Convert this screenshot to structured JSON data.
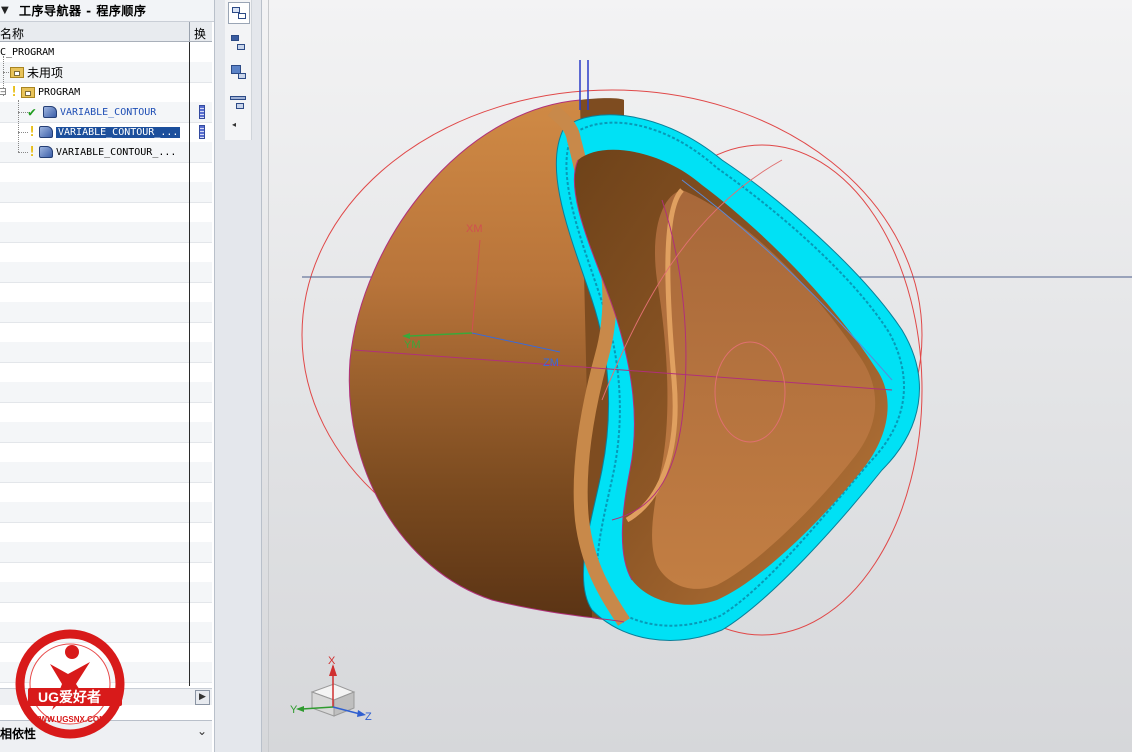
{
  "navigator": {
    "title": "工序导航器 - 程序顺序",
    "header": {
      "name_col": "名称",
      "swap_col": "换"
    },
    "rows": [
      {
        "label": "C_PROGRAM",
        "level": 0
      },
      {
        "label": "未用项",
        "level": 1
      },
      {
        "label": "PROGRAM",
        "level": 1
      },
      {
        "label": "VARIABLE_CONTOUR",
        "level": 2,
        "status": "complete"
      },
      {
        "label": "VARIABLE_CONTOUR_...",
        "level": 2,
        "status": "regenerate",
        "selected": true
      },
      {
        "label": "VARIABLE_CONTOUR_...",
        "level": 2,
        "status": "regenerate"
      }
    ],
    "dependency_panel": "相依性"
  },
  "viewport": {
    "wcs_labels": {
      "xm": "XM",
      "ym": "YM",
      "zm": "ZM"
    },
    "triad_labels": {
      "x": "X",
      "y": "Y",
      "z": "Z"
    },
    "colors": {
      "part": "#b8743a",
      "toolpath": "#00e5ff",
      "xm": "#d05050",
      "ym": "#3aa83a",
      "zm": "#3a6ad8"
    }
  },
  "watermark": {
    "brand": "UG爱好者",
    "url": "WWW.UGSNX.COM"
  }
}
